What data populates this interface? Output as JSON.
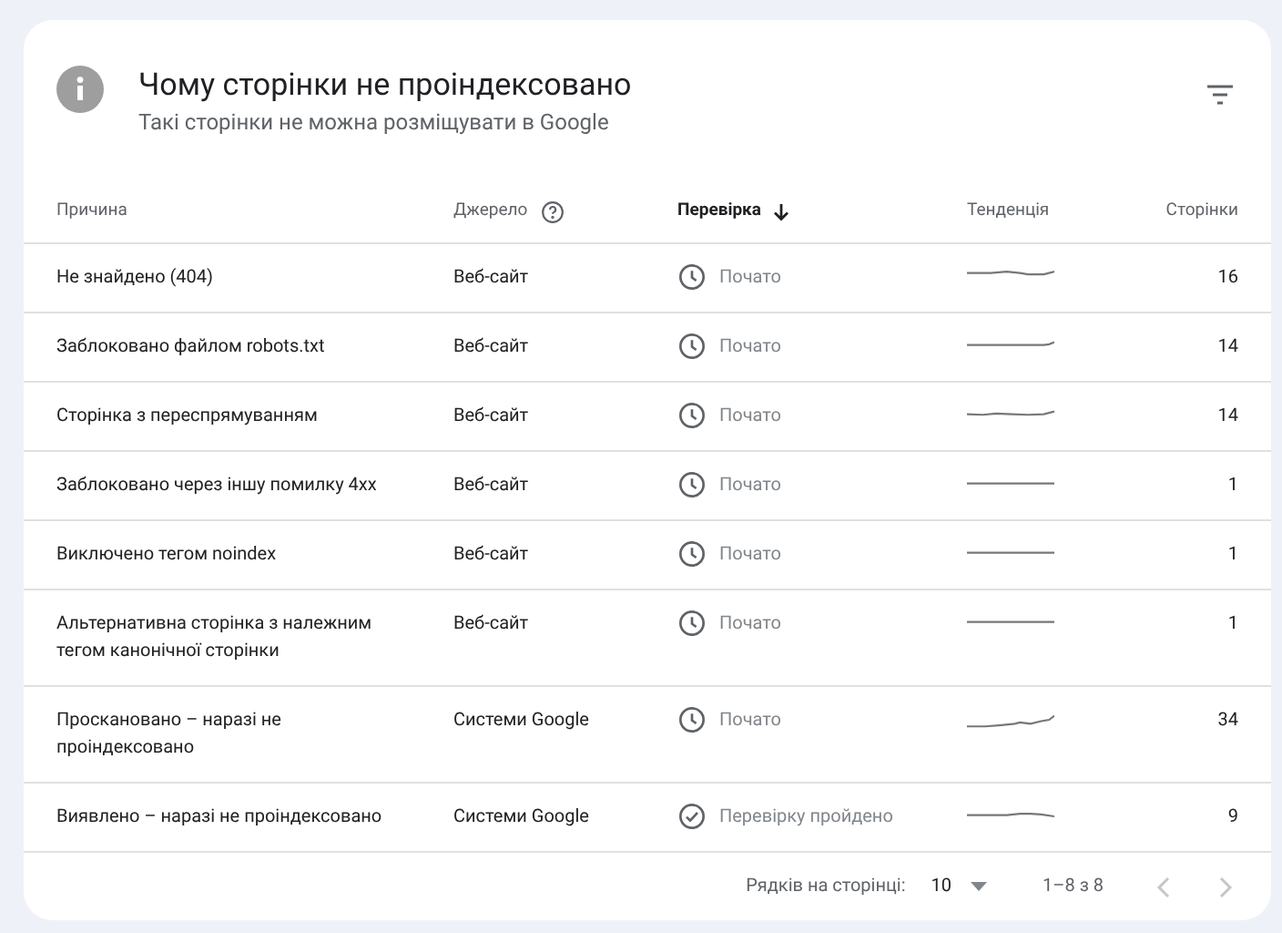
{
  "header": {
    "title": "Чому сторінки не проіндексовано",
    "subtitle": "Такі сторінки не можна розміщувати в Google"
  },
  "table": {
    "columns": [
      {
        "label": "Причина",
        "sorted": false,
        "help": false
      },
      {
        "label": "Джерело",
        "sorted": false,
        "help": true
      },
      {
        "label": "Перевірка",
        "sorted": true,
        "help": false
      },
      {
        "label": "Тенденція",
        "sorted": false,
        "help": false
      },
      {
        "label": "Сторінки",
        "sorted": false,
        "help": false
      }
    ],
    "rows": [
      {
        "reason": "Не знайдено (404)",
        "source": "Веб-сайт",
        "status": {
          "kind": "started",
          "label": "Почато"
        },
        "pages": "16"
      },
      {
        "reason": "Заблоковано файлом robots.txt",
        "source": "Веб-сайт",
        "status": {
          "kind": "started",
          "label": "Почато"
        },
        "pages": "14"
      },
      {
        "reason": "Сторінка з переспрямуванням",
        "source": "Веб-сайт",
        "status": {
          "kind": "started",
          "label": "Почато"
        },
        "pages": "14"
      },
      {
        "reason": "Заблоковано через іншу помилку 4xx",
        "source": "Веб-сайт",
        "status": {
          "kind": "started",
          "label": "Почато"
        },
        "pages": "1"
      },
      {
        "reason": "Виключено тегом noindex",
        "source": "Веб-сайт",
        "status": {
          "kind": "started",
          "label": "Почато"
        },
        "pages": "1"
      },
      {
        "reason": "Альтернативна сторінка з належним тегом канонічної сторінки",
        "source": "Веб-сайт",
        "status": {
          "kind": "started",
          "label": "Почато"
        },
        "pages": "1"
      },
      {
        "reason": "Проскановано – наразі не проіндексовано",
        "source": "Системи Google",
        "status": {
          "kind": "started",
          "label": "Почато"
        },
        "pages": "34"
      },
      {
        "reason": "Виявлено – наразі не проіндексовано",
        "source": "Системи Google",
        "status": {
          "kind": "passed",
          "label": "Перевірку пройдено"
        },
        "pages": "9"
      }
    ]
  },
  "pagination": {
    "rows_label": "Рядків на сторінці:",
    "rows_value": "10",
    "range": "1–8 з 8",
    "prev_disabled": true,
    "next_disabled": true
  }
}
